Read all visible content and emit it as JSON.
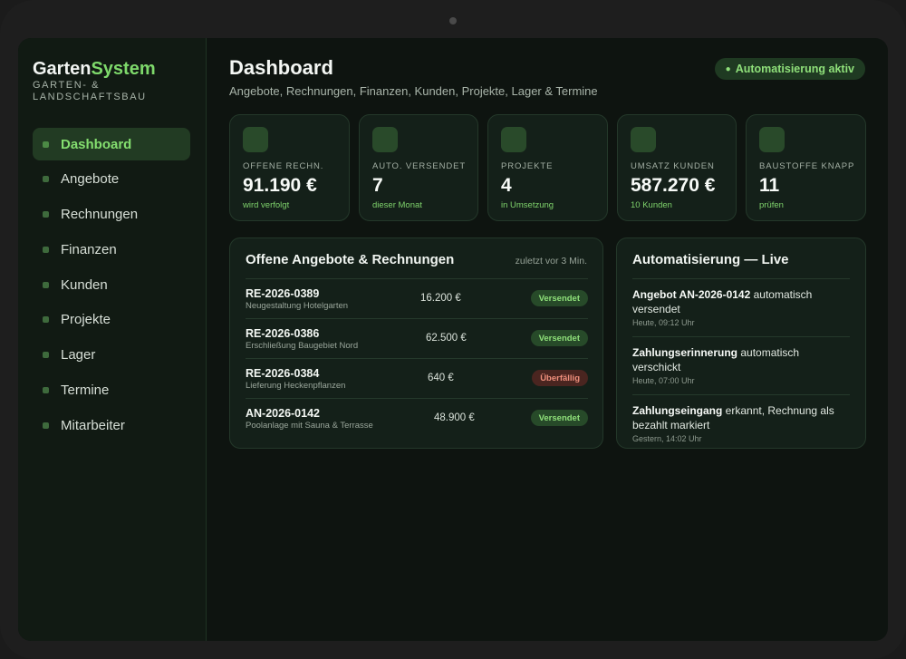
{
  "app": {
    "brand_part1": "Garten",
    "brand_part2": "System",
    "brand_subtitle": "GARTEN- & LANDSCHAFTSBAU"
  },
  "sidebar": {
    "items": [
      {
        "label": "Dashboard",
        "active": true
      },
      {
        "label": "Angebote"
      },
      {
        "label": "Rechnungen"
      },
      {
        "label": "Finanzen"
      },
      {
        "label": "Kunden"
      },
      {
        "label": "Projekte"
      },
      {
        "label": "Lager"
      },
      {
        "label": "Termine"
      },
      {
        "label": "Mitarbeiter"
      }
    ]
  },
  "header": {
    "title": "Dashboard",
    "subtitle": "Angebote, Rechnungen, Finanzen, Kunden, Projekte, Lager & Termine",
    "badge": "Automatisierung aktiv",
    "badge_dot": "●"
  },
  "kpis": [
    {
      "label": "OFFENE RECHN.",
      "value": "91.190 €",
      "note": "wird verfolgt"
    },
    {
      "label": "AUTO. VERSENDET",
      "value": "7",
      "note": "dieser Monat"
    },
    {
      "label": "PROJEKTE",
      "value": "4",
      "note": "in Umsetzung"
    },
    {
      "label": "UMSATZ KUNDEN",
      "value": "587.270 €",
      "note": "10 Kunden"
    },
    {
      "label": "BAUSTOFFE KNAPP",
      "value": "11",
      "note": "prüfen"
    }
  ],
  "documents": {
    "title": "Offene Angebote & Rechnungen",
    "meta": "zuletzt vor 3 Min.",
    "rows": [
      {
        "ref": "RE-2026-0389",
        "desc": "Neugestaltung Hotelgarten",
        "amount": "16.200 €",
        "status": "Versendet",
        "state": "ok"
      },
      {
        "ref": "RE-2026-0386",
        "desc": "Erschließung Baugebiet Nord",
        "amount": "62.500 €",
        "status": "Versendet",
        "state": "ok"
      },
      {
        "ref": "RE-2026-0384",
        "desc": "Lieferung Heckenpflanzen",
        "amount": "640 €",
        "status": "Überfällig",
        "state": "late"
      },
      {
        "ref": "AN-2026-0142",
        "desc": "Poolanlage mit Sauna & Terrasse",
        "amount": "48.900 €",
        "status": "Versendet",
        "state": "ok"
      }
    ]
  },
  "automation": {
    "title": "Automatisierung — Live",
    "events": [
      {
        "bold": "Angebot AN-2026-0142",
        "text": " automatisch versendet",
        "time": "Heute, 09:12 Uhr"
      },
      {
        "bold": "Zahlungserinnerung",
        "text": " automatisch verschickt",
        "time": "Heute, 07:00 Uhr"
      },
      {
        "bold": "Zahlungseingang",
        "text": " erkannt, Rechnung als bezahlt markiert",
        "time": "Gestern, 14:02 Uhr"
      }
    ]
  }
}
